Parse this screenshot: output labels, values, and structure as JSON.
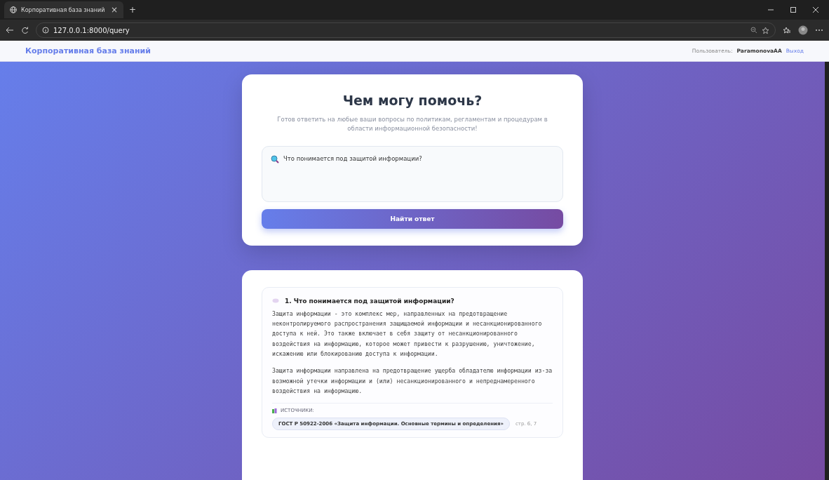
{
  "browser": {
    "tab_title": "Корпоративная база знаний",
    "tab_close": "×",
    "new_tab": "+",
    "url": "127.0.0.1:8000/query"
  },
  "header": {
    "brand": "Корпоративная база знаний",
    "user_label": "Пользователь:",
    "user_name": "ParamonovaAA",
    "logout": "Выход"
  },
  "query_card": {
    "title": "Чем могу помочь?",
    "subtitle": "Готов ответить на любые ваши вопросы по политикам, регламентам и процедурам в области информационной безопасности!",
    "query": "Что понимается под защитой информации?",
    "submit": "Найти ответ"
  },
  "answers": [
    {
      "title": "1. Что понимается под защитой информации?",
      "paragraphs": [
        "Защита информации - это комплекс мер, направленных на предотвращение неконтролируемого распространения защищаемой информации и несанкционированного доступа к ней. Это также включает в себя защиту от несанкционированного воздействия на информацию, которое может привести к разрушению, уничтожение, искажению или блокированию доступа к информации.",
        "Защита информации направлена на предотвращение ущерба обладателю информации из-за возможной утечки информации и (или) несанкционированного и непреднамеренного воздействия на информацию."
      ],
      "sources_label": "ИСТОЧНИКИ:",
      "sources": [
        {
          "title": "ГОСТ Р 50922-2006 «Защита информации. Основные термины и определения»",
          "pages": "стр. 6, 7"
        }
      ]
    }
  ]
}
